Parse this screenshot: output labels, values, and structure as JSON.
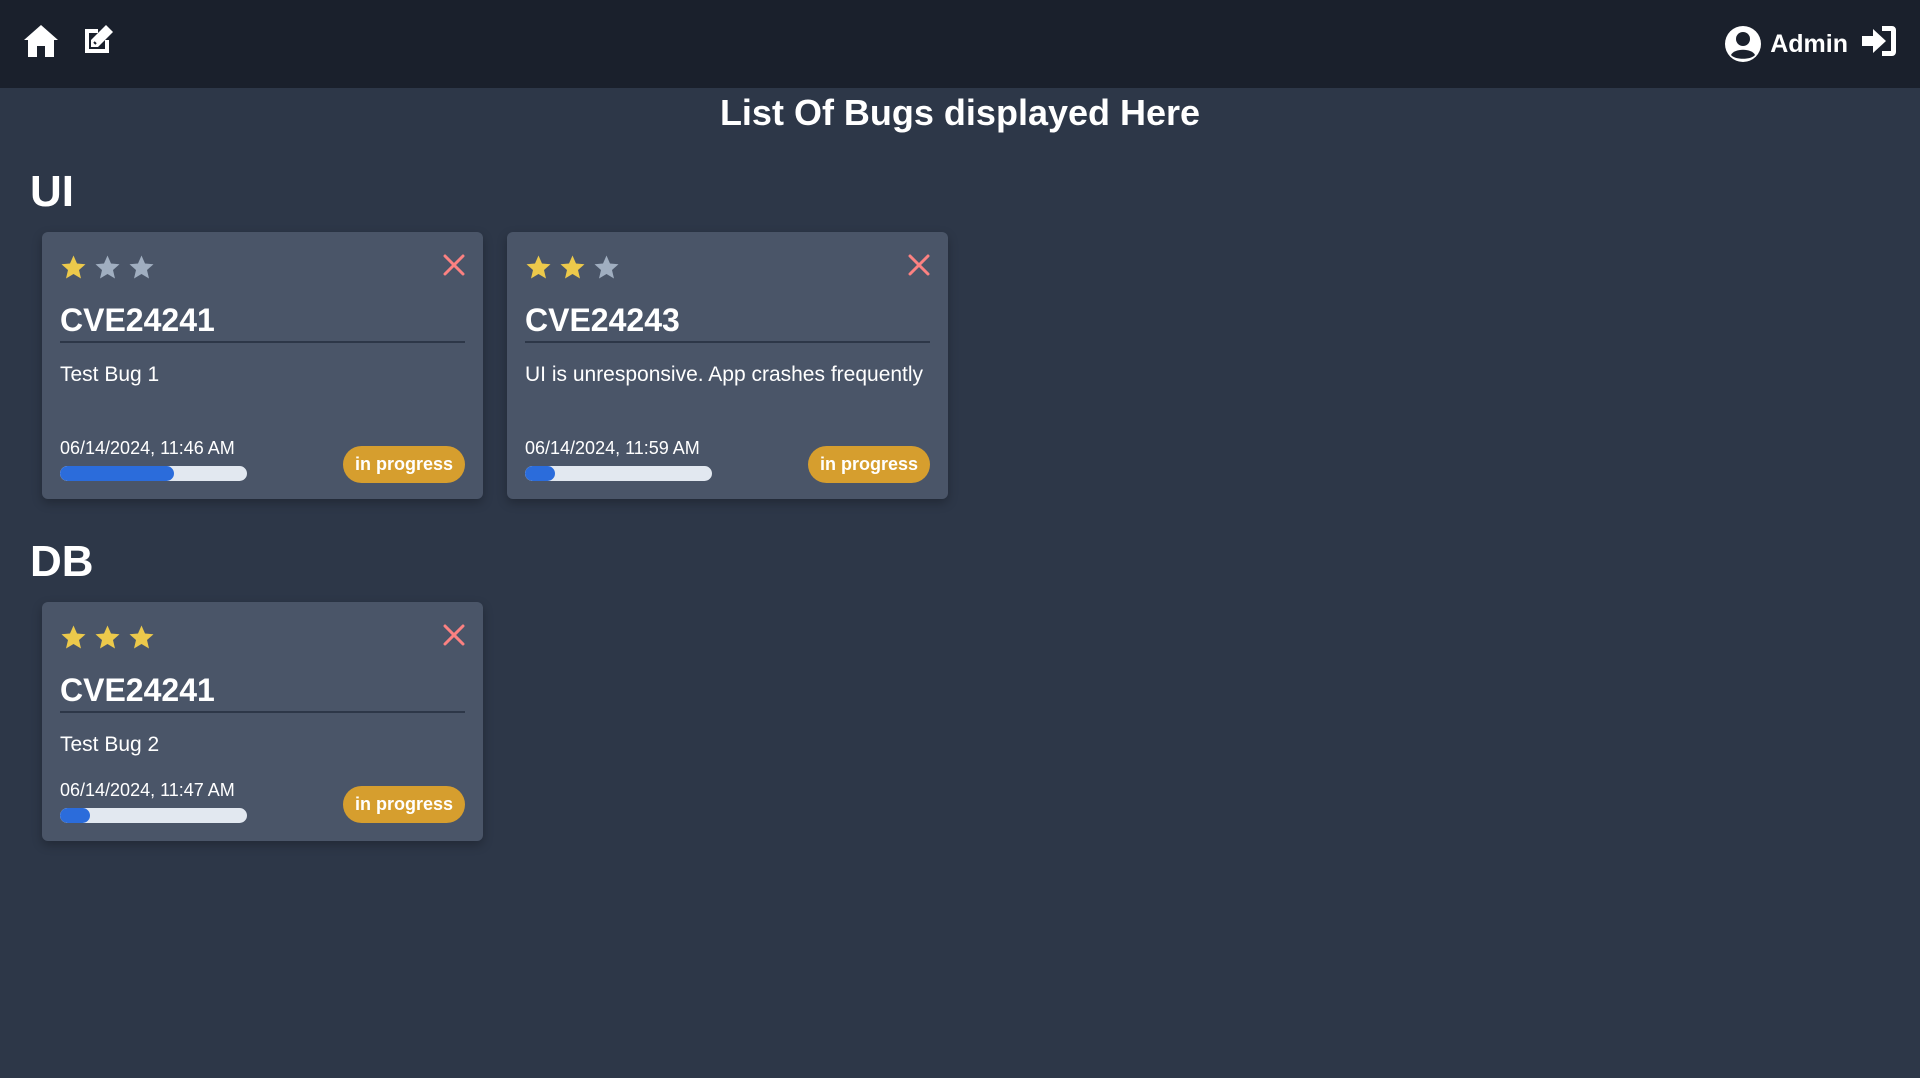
{
  "nav": {
    "home_icon": "home-icon",
    "edit_icon": "edit-icon",
    "user_icon": "user-circle-icon",
    "user_label": "Admin",
    "logout_icon": "sign-in-icon"
  },
  "page": {
    "title": "List Of Bugs displayed Here"
  },
  "colors": {
    "navbar_bg": "#1a202c",
    "page_bg": "#2d3748",
    "card_bg": "#4a5568",
    "star_filled": "#ecc94b",
    "star_empty": "#a0aec0",
    "close": "#fc8181",
    "progress_fill": "#2b6cdb",
    "progress_track": "#e2e8f0",
    "status_badge": "#d69e2e"
  },
  "sections": [
    {
      "heading": "UI",
      "cards": [
        {
          "rating": 1,
          "max_rating": 3,
          "title": "CVE24241",
          "description": "Test Bug 1",
          "date": "06/14/2024, 11:46 AM",
          "progress": 0.61,
          "status": "in progress"
        },
        {
          "rating": 2,
          "max_rating": 3,
          "title": "CVE24243",
          "description": "UI is unresponsive. App crashes frequently",
          "date": "06/14/2024, 11:59 AM",
          "progress": 0.16,
          "status": "in progress"
        }
      ]
    },
    {
      "heading": "DB",
      "cards": [
        {
          "rating": 3,
          "max_rating": 3,
          "title": "CVE24241",
          "description": "Test Bug 2",
          "date": "06/14/2024, 11:47 AM",
          "progress": 0.16,
          "status": "in progress"
        }
      ]
    }
  ]
}
